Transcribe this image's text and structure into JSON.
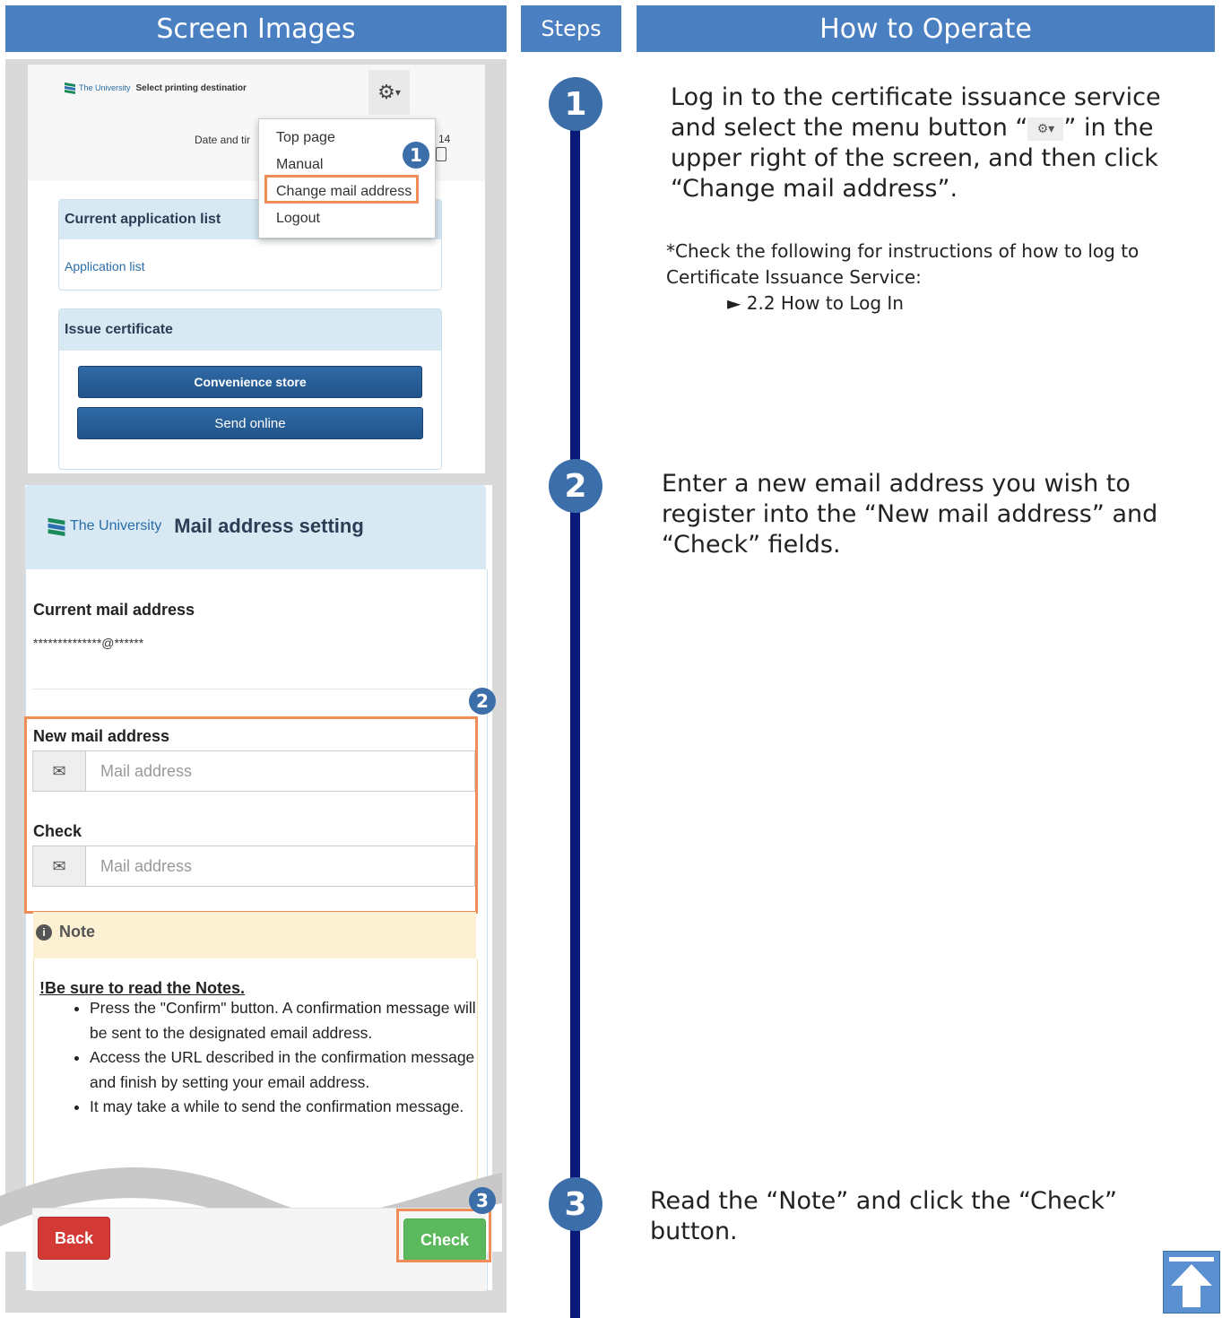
{
  "headers": {
    "screen_images": "Screen Images",
    "steps": "Steps",
    "how_to_operate": "How to Operate"
  },
  "screen1": {
    "brand": "The University",
    "page_label": "Select printing destinatior",
    "date_label": "Date and tir",
    "date_fragment": "14",
    "menu_items": [
      "Top page",
      "Manual",
      "Change mail address",
      "Logout"
    ],
    "current_application_list": "Current application list",
    "application_list_link": "Application list",
    "issue_certificate": "Issue certificate",
    "convenience_store": "Convenience store",
    "send_online": "Send online",
    "badge": "1"
  },
  "screen2": {
    "brand": "The University",
    "title": "Mail address setting",
    "current_mail_label": "Current mail address",
    "current_mail_value": "**************@******",
    "badge": "2",
    "new_mail_label": "New mail address",
    "new_mail_placeholder": "Mail address",
    "check_label": "Check",
    "check_placeholder": "Mail address",
    "note_header": "Note",
    "notes_title": "!Be sure to read the Notes.",
    "notes": [
      "Press the \"Confirm\" button. A confirmation message will be sent to the designated email address.",
      "Access the URL described in the confirmation message and finish by setting your email address.",
      "It may take a while to send the confirmation message."
    ],
    "badge3": "3",
    "back_button": "Back",
    "check_button": "Check"
  },
  "steps": {
    "step1": "1",
    "step2": "2",
    "step3": "3"
  },
  "instructions": {
    "step1_pre": "Log in to the certificate issuance service and select the menu button “",
    "step1_post": "” in the upper right of the screen, and then click “Change mail address”.",
    "step1_note_line1": "*Check the following for instructions of how to log to",
    "step1_note_line2": "Certificate Issuance Service:",
    "step1_note_link": "► 2.2 How to Log In",
    "step2": "Enter a new email address you wish to register into the “New mail address” and “Check” fields.",
    "step3": "Read the “Note” and click the “Check” button."
  },
  "icons": [
    "gear-icon",
    "envelope-icon",
    "info-icon",
    "back-to-top-icon"
  ],
  "colors": {
    "header_blue": "#4a7fc1",
    "step_circle": "#3c6eaa",
    "timeline_navy": "#0a1a7a",
    "highlight_orange": "#f08c55",
    "back_red": "#d33a36",
    "check_green": "#5cb85c"
  }
}
